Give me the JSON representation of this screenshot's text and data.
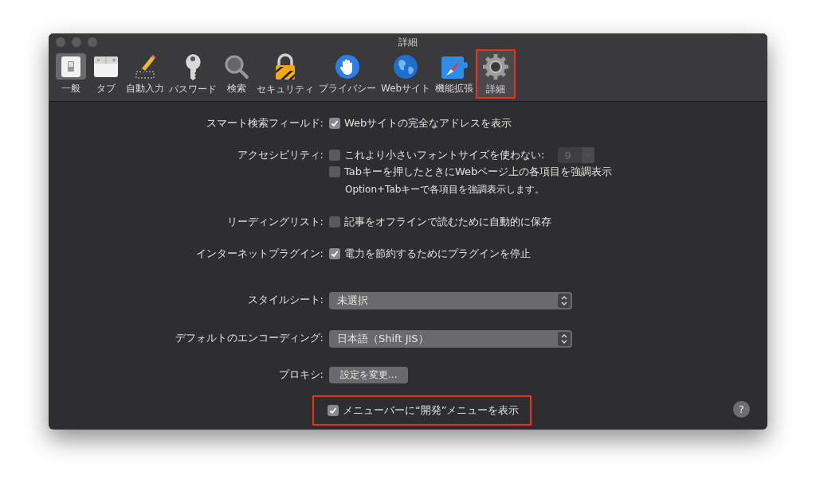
{
  "window": {
    "title": "詳細"
  },
  "toolbar": [
    {
      "label": "一般",
      "kind": "switch",
      "selected": true,
      "highlighted": false
    },
    {
      "label": "タブ",
      "kind": "tabs",
      "selected": false,
      "highlighted": false
    },
    {
      "label": "自動入力",
      "kind": "pencil",
      "selected": false,
      "highlighted": false
    },
    {
      "label": "パスワード",
      "kind": "key",
      "selected": false,
      "highlighted": false
    },
    {
      "label": "検索",
      "kind": "search",
      "selected": false,
      "highlighted": false
    },
    {
      "label": "セキュリティ",
      "kind": "lock",
      "selected": false,
      "highlighted": false
    },
    {
      "label": "プライバシー",
      "kind": "hand",
      "selected": false,
      "highlighted": false
    },
    {
      "label": "Webサイト",
      "kind": "globe",
      "selected": false,
      "highlighted": false
    },
    {
      "label": "機能拡張",
      "kind": "compass",
      "selected": false,
      "highlighted": false
    },
    {
      "label": "詳細",
      "kind": "gear",
      "selected": false,
      "highlighted": true
    }
  ],
  "settings": [
    {
      "kind": "checkbox",
      "label": "スマート検索フィールド:",
      "options": [
        {
          "text": "Webサイトの完全なアドレスを表示",
          "checked": true
        }
      ]
    },
    {
      "kind": "checkbox",
      "label": "アクセシビリティ:",
      "options": [
        {
          "text": "これより小さいフォントサイズを使わない:",
          "checked": false,
          "stepper": "9"
        },
        {
          "text": "Tabキーを押したときにWebページ上の各項目を強調表示",
          "checked": false
        }
      ],
      "note": "Option+Tabキーで各項目を強調表示します。"
    },
    {
      "kind": "checkbox",
      "label": "リーディングリスト:",
      "options": [
        {
          "text": "記事をオフラインで読むために自動的に保存",
          "checked": false
        }
      ]
    },
    {
      "kind": "checkbox",
      "label": "インターネットプラグイン:",
      "options": [
        {
          "text": "電力を節約するためにプラグインを停止",
          "checked": true
        }
      ]
    },
    {
      "kind": "popup",
      "label": "スタイルシート:",
      "value": "未選択"
    },
    {
      "kind": "popup",
      "label": "デフォルトのエンコーディング:",
      "value": "日本語（Shift JIS）"
    },
    {
      "kind": "button",
      "label": "プロキシ:",
      "value": "設定を変更..."
    },
    {
      "kind": "checkbox",
      "options": [
        {
          "text": "メニューバーに“開発”メニューを表示",
          "checked": true,
          "highlighted": true
        }
      ]
    }
  ],
  "help": "?"
}
